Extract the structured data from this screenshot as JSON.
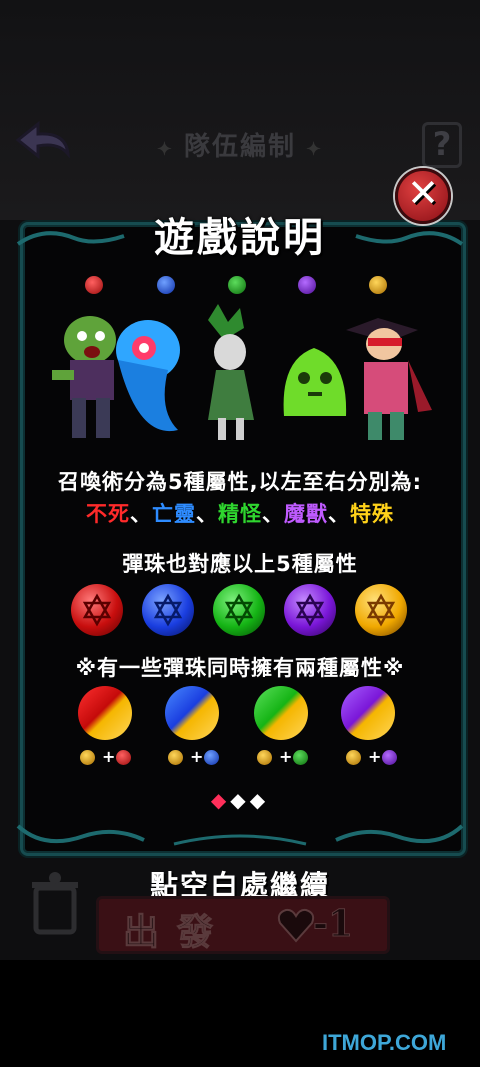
{
  "header": {
    "title": "隊伍編制",
    "help_label": "?"
  },
  "dialog": {
    "title": "遊戲說明",
    "close_label": "✕",
    "attributes_intro": "召喚術分為5種屬性,以左至右分別為:",
    "attributes": [
      {
        "name": "不死",
        "color": "#ff2a2a"
      },
      {
        "name": "亡靈",
        "color": "#2e8cff"
      },
      {
        "name": "精怪",
        "color": "#2fd62f"
      },
      {
        "name": "魔獸",
        "color": "#c05bff"
      },
      {
        "name": "特殊",
        "color": "#ffd21a"
      }
    ],
    "separator": "、",
    "orbs_text": "彈珠也對應以上5種屬性",
    "dual_text": "※有一些彈珠同時擁有兩種屬性※",
    "combo_plus": "+",
    "pager": [
      "◆",
      "◆",
      "◆"
    ],
    "pager_active_index": 0
  },
  "continue_text": "點空白處繼續",
  "start_button": {
    "label": "出發",
    "cost": "-1"
  },
  "watermark": "ITMOP.COM",
  "colors": {
    "red": "#e01818",
    "blue": "#1a52ff",
    "green": "#19c419",
    "purple": "#8a1ee8",
    "gold": "#f5b600",
    "frame": "#164c50"
  }
}
